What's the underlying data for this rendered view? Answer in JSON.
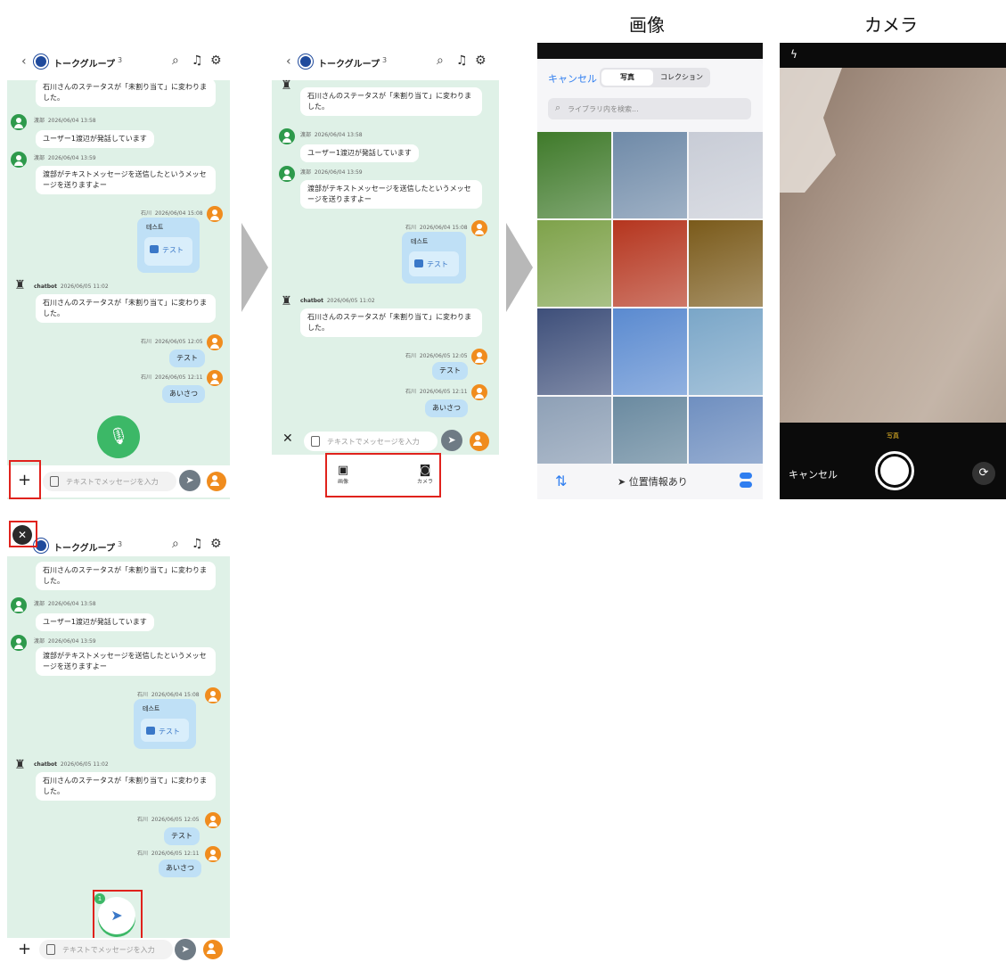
{
  "captions": {
    "image": "画像",
    "camera": "カメラ"
  },
  "chat": {
    "group_title": "トークグループ",
    "member_count": "3",
    "messages": {
      "status_change": "石川さんのステータスが「未割り当て」に変わりました。",
      "m1_sender": "渡部",
      "m1_time": "2026/06/04 13:58",
      "m1_text": "ユーザー1渡辺が発話しています",
      "m2_sender": "渡部",
      "m2_time": "2026/06/04 13:59",
      "m2_text": "渡部がテキストメッセージを送信したというメッセージを送りますよー",
      "m3_sender": "石川",
      "m3_time": "2026/06/04 15:08",
      "m3_attach_title": "테스트",
      "m3_attach_name": "テスト",
      "m4_sender": "chatbot",
      "m4_time": "2026/06/05 11:02",
      "m5_sender": "石川",
      "m5_time": "2026/06/05 12:05",
      "m5_text": "テスト",
      "m6_sender": "石川",
      "m6_time": "2026/06/05 12:11",
      "m6_text": "あいさつ"
    },
    "input_placeholder": "テキストでメッセージを入力",
    "attach_image_label": "画像",
    "attach_camera_label": "カメラ",
    "fab_badge": "1"
  },
  "gallery": {
    "cancel": "キャンセル",
    "tab_photos": "写真",
    "tab_collections": "コレクション",
    "search_placeholder": "ライブラリ内を検索...",
    "location": "位置情報あり",
    "tiles": [
      "#3f7a2a",
      "#6f8aa8",
      "#c8ccd6",
      "#7ea24a",
      "#b5351e",
      "#7a5a1a",
      "#3e4f7a",
      "#5a8ad0",
      "#7aa6c8",
      "#8ea0b6",
      "#6a8aa0",
      "#6f8fc0"
    ]
  },
  "camera": {
    "mode": "写真",
    "cancel": "キャンセル"
  }
}
